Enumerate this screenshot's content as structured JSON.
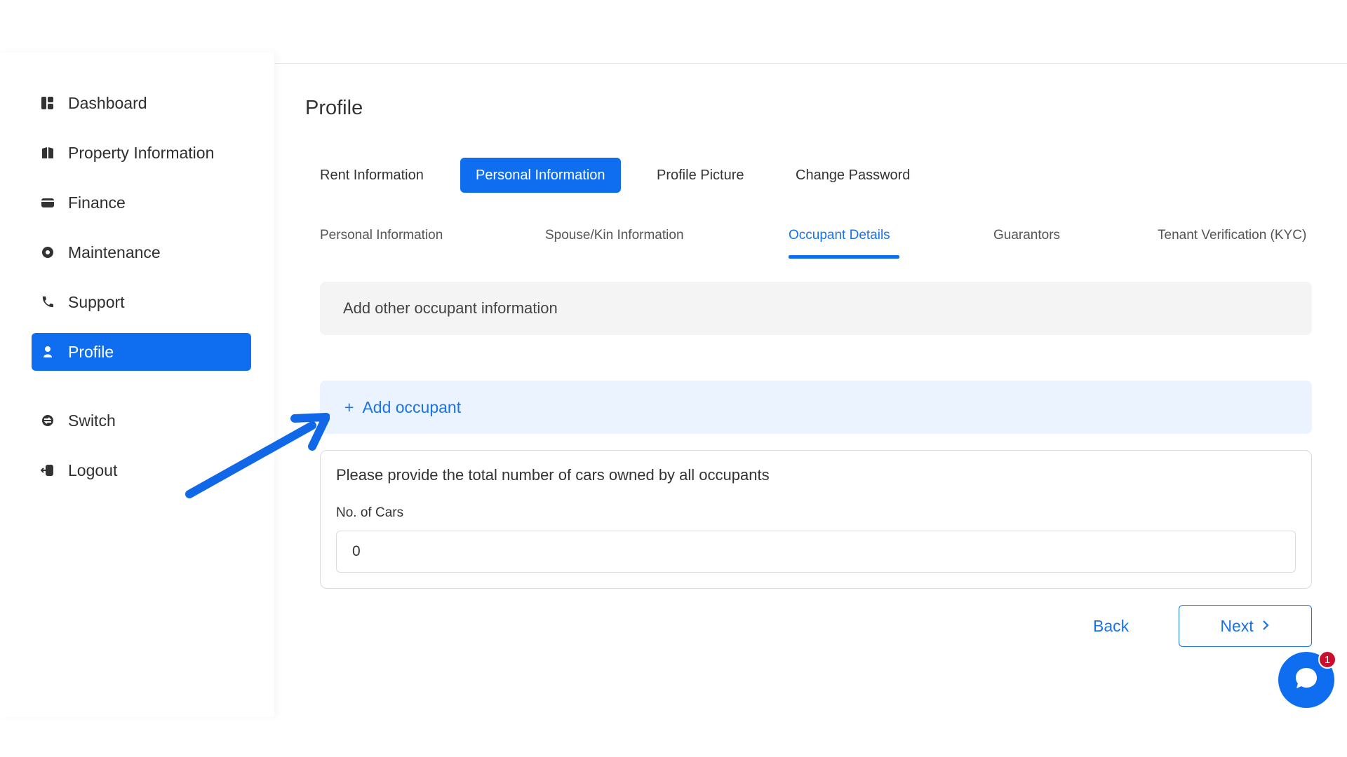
{
  "sidebar": {
    "items": [
      {
        "label": "Dashboard",
        "icon": "dashboard-icon"
      },
      {
        "label": "Property Information",
        "icon": "building-icon"
      },
      {
        "label": "Finance",
        "icon": "wallet-icon"
      },
      {
        "label": "Maintenance",
        "icon": "gear-icon"
      },
      {
        "label": "Support",
        "icon": "phone-icon"
      },
      {
        "label": "Profile",
        "icon": "user-icon",
        "active": true
      },
      {
        "label": "Switch",
        "icon": "switch-icon"
      },
      {
        "label": "Logout",
        "icon": "logout-icon"
      }
    ]
  },
  "page": {
    "title": "Profile"
  },
  "tabs": [
    "Rent Information",
    "Personal Information",
    "Profile Picture",
    "Change Password"
  ],
  "active_tab": "Personal Information",
  "subtabs": [
    "Personal Information",
    "Spouse/Kin Information",
    "Occupant Details",
    "Guarantors",
    "Tenant Verification (KYC)"
  ],
  "active_subtab": "Occupant Details",
  "occupant": {
    "info_text": "Add other occupant information",
    "add_label": "Add occupant",
    "add_prefix": "+"
  },
  "cars": {
    "question": "Please provide the total number of cars owned by all occupants",
    "label": "No. of Cars",
    "value": "0"
  },
  "footer": {
    "back_label": "Back",
    "next_label": "Next"
  },
  "chat": {
    "badge_count": "1"
  },
  "colors": {
    "accent": "#0f6ef0",
    "link": "#1a73e8",
    "badge": "#c8102e"
  }
}
